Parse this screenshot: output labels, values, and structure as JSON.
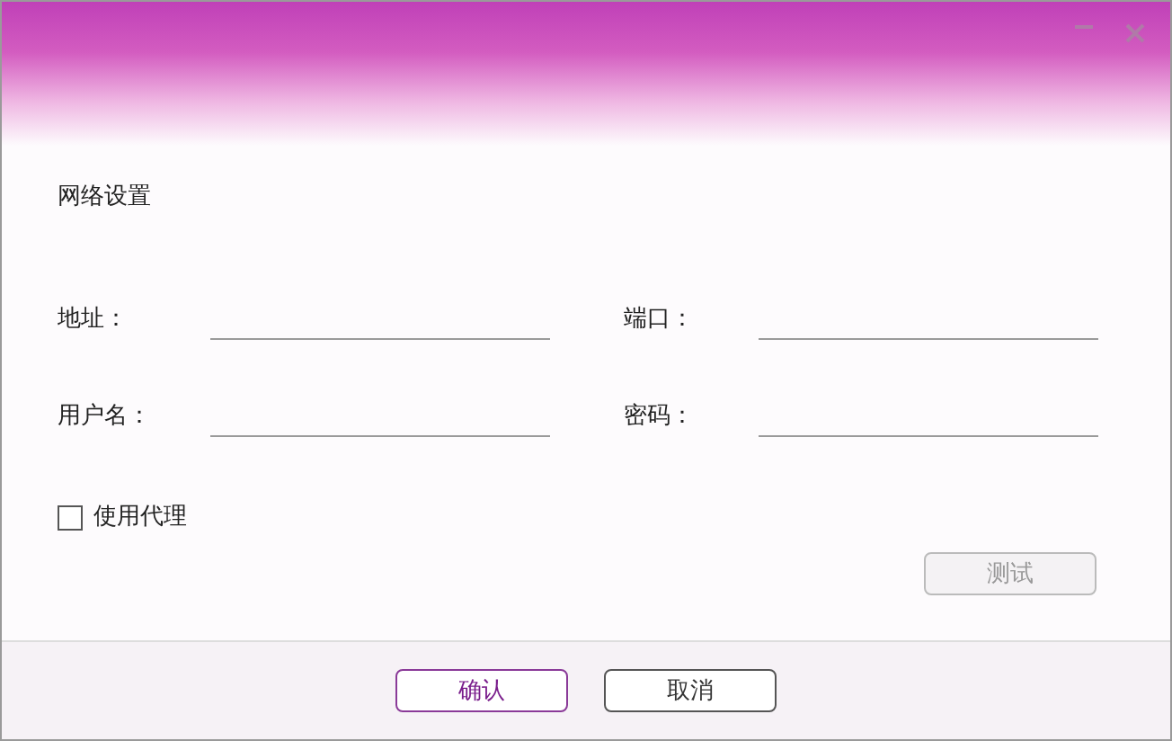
{
  "section_title": "网络设置",
  "fields": [
    {
      "label": "地址："
    },
    {
      "label": "端口："
    },
    {
      "label": "用户名："
    },
    {
      "label": "密码："
    }
  ],
  "proxy": {
    "label": "使用代理",
    "checked": false
  },
  "test_button": {
    "label": "测试",
    "disabled": true
  },
  "buttons": [
    {
      "label": "确认",
      "kind": "primary"
    },
    {
      "label": "取消",
      "kind": "secondary"
    }
  ]
}
